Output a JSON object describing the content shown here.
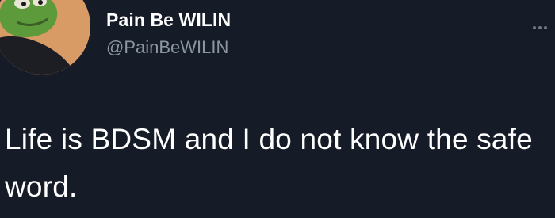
{
  "tweet": {
    "author": {
      "display_name": "Pain Be WILIN",
      "handle": "@PainBeWILIN",
      "avatar_icon": "frog-avatar-icon"
    },
    "text": "Life is BDSM and I do not know the safe word.",
    "more_icon": "more-options-icon"
  },
  "colors": {
    "background": "#151c27",
    "name": "#ffffff",
    "handle": "#8a97a3",
    "text": "#ffffff",
    "avatar_bg": "#d99b66"
  }
}
